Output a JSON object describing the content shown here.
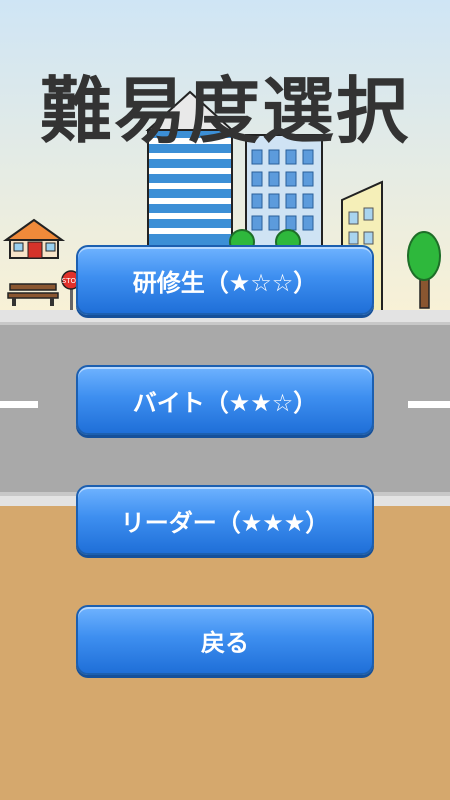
{
  "screen": {
    "title": "難易度選択"
  },
  "menu": {
    "trainee_label": "研修生（★☆☆）",
    "parttime_label": "バイト（★★☆）",
    "leader_label": "リーダー（★★★）",
    "back_label": "戻る"
  },
  "background": {
    "sign_text": "STOP"
  },
  "colors": {
    "sky_top": "#cfe5f5",
    "sky_bottom": "#f8f1d6",
    "road": "#a9a9a9",
    "ground": "#d5a86d",
    "button": "#3e8ff0"
  }
}
